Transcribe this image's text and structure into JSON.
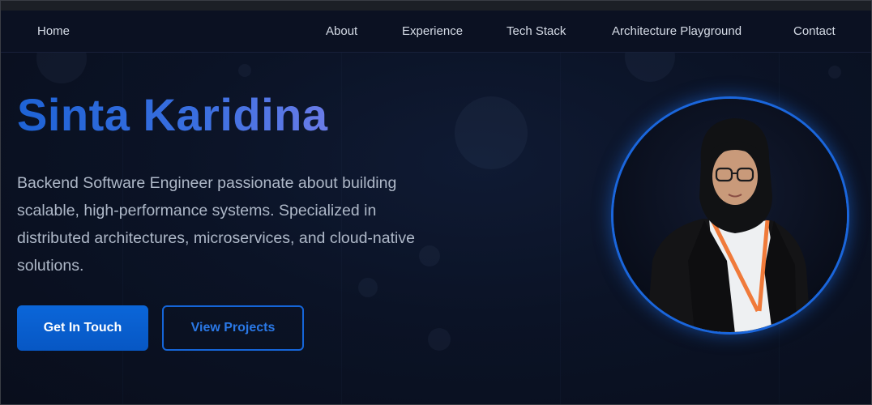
{
  "nav": {
    "home": "Home",
    "about": "About",
    "experience": "Experience",
    "tech_stack": "Tech Stack",
    "architecture": "Architecture Playground",
    "contact": "Contact"
  },
  "hero": {
    "name": "Sinta Karidina",
    "description": "Backend Software Engineer passionate about building scalable, high-performance systems. Specialized in distributed architectures, microservices, and cloud-native solutions.",
    "primary_button": "Get In Touch",
    "secondary_button": "View Projects"
  },
  "colors": {
    "background": "#0b1020",
    "accent": "#1565d8",
    "name_gradient_start": "#1e63d6",
    "name_gradient_end": "#6a7ce8",
    "text": "#aeb8c8"
  },
  "icons": {
    "avatar": "profile-photo"
  }
}
